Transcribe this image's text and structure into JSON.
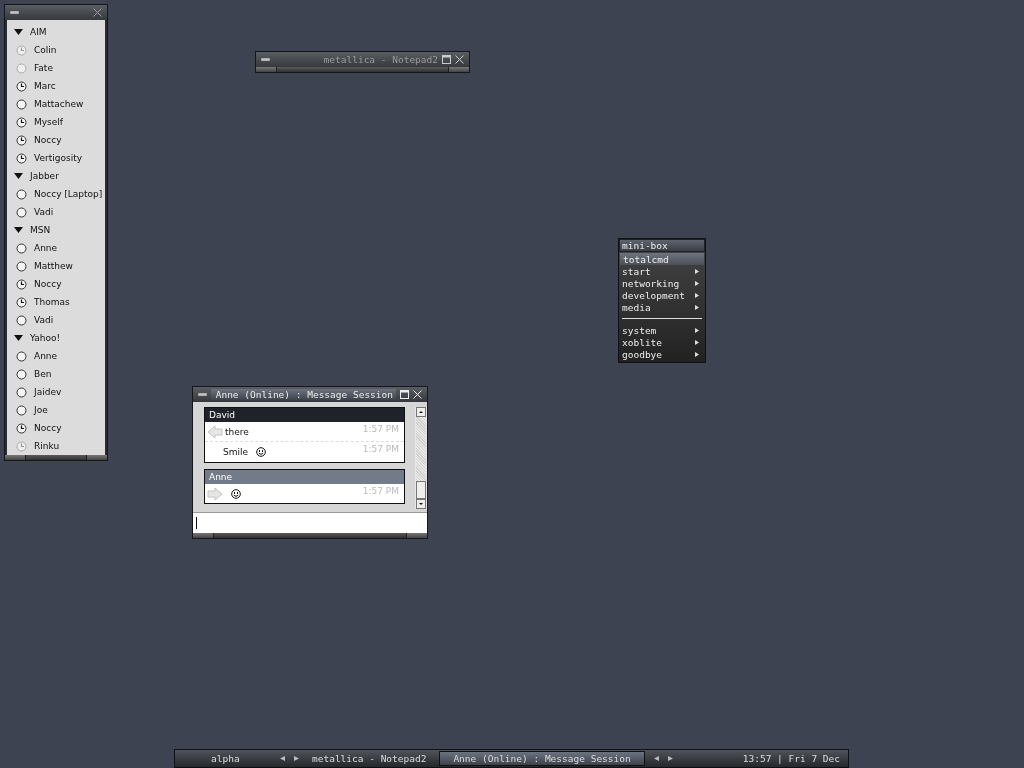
{
  "buddy_list": {
    "groups": [
      {
        "name": "AIM",
        "expanded": true,
        "children": [
          {
            "name": "Colin",
            "kind": "idle",
            "dimmed": true
          },
          {
            "name": "Fate",
            "kind": "online",
            "dimmed": true
          },
          {
            "name": "Marc",
            "kind": "idle",
            "dimmed": false
          },
          {
            "name": "Mattachew",
            "kind": "online",
            "dimmed": false
          },
          {
            "name": "Myself",
            "kind": "idle",
            "dimmed": false
          },
          {
            "name": "Noccy",
            "kind": "idle",
            "dimmed": false
          },
          {
            "name": "Vertigosity",
            "kind": "idle",
            "dimmed": false
          }
        ]
      },
      {
        "name": "Jabber",
        "expanded": true,
        "children": [
          {
            "name": "Noccy [Laptop]",
            "kind": "online",
            "dimmed": false
          },
          {
            "name": "Vadi",
            "kind": "online",
            "dimmed": false
          }
        ]
      },
      {
        "name": "MSN",
        "expanded": true,
        "children": [
          {
            "name": "Anne",
            "kind": "online",
            "dimmed": false
          },
          {
            "name": "Matthew",
            "kind": "online",
            "dimmed": false
          },
          {
            "name": "Noccy",
            "kind": "idle",
            "dimmed": false
          },
          {
            "name": "Thomas",
            "kind": "idle",
            "dimmed": false
          },
          {
            "name": "Vadi",
            "kind": "online",
            "dimmed": false
          }
        ]
      },
      {
        "name": "Yahoo!",
        "expanded": true,
        "children": [
          {
            "name": "Anne",
            "kind": "online",
            "dimmed": false
          },
          {
            "name": "Ben",
            "kind": "online",
            "dimmed": false
          },
          {
            "name": "Jaidev",
            "kind": "online",
            "dimmed": false
          },
          {
            "name": "Joe",
            "kind": "online",
            "dimmed": false
          },
          {
            "name": "Noccy",
            "kind": "idle",
            "dimmed": false
          },
          {
            "name": "Rinku",
            "kind": "idle",
            "dimmed": true
          }
        ]
      }
    ]
  },
  "notepad_window": {
    "title": "metallica - Notepad2"
  },
  "menu": {
    "title": "mini-box",
    "items": [
      {
        "kind": "item",
        "label": "totalcmd",
        "selected": true,
        "submenu": false
      },
      {
        "kind": "item",
        "label": "start",
        "selected": false,
        "submenu": true
      },
      {
        "kind": "item",
        "label": "networking",
        "selected": false,
        "submenu": true
      },
      {
        "kind": "item",
        "label": "development",
        "selected": false,
        "submenu": true
      },
      {
        "kind": "item",
        "label": "media",
        "selected": false,
        "submenu": true
      },
      {
        "kind": "separator"
      },
      {
        "kind": "item",
        "label": "system",
        "selected": false,
        "submenu": true
      },
      {
        "kind": "item",
        "label": "xoblite",
        "selected": false,
        "submenu": true
      },
      {
        "kind": "item",
        "label": "goodbye",
        "selected": false,
        "submenu": true
      }
    ]
  },
  "message_window": {
    "title": "Anne (Online) : Message Session",
    "messages": [
      {
        "sender": "David",
        "kind": "incoming",
        "lines": [
          {
            "text": "there",
            "time": "1:57 PM",
            "smiley": false
          },
          {
            "text": "Smile",
            "time": "1:57 PM",
            "smiley": true
          }
        ]
      },
      {
        "sender": "Anne",
        "kind": "outgoing",
        "lines": [
          {
            "time": "1:57 PM",
            "smiley": true
          }
        ]
      }
    ]
  },
  "taskbar": {
    "workspace": "alpha",
    "tasks": [
      {
        "label": "metallica - Notepad2",
        "selected": false
      },
      {
        "label": "Anne (Online) : Message Session",
        "selected": true
      }
    ],
    "clock": "13:57 | Fri 7 Dec"
  }
}
